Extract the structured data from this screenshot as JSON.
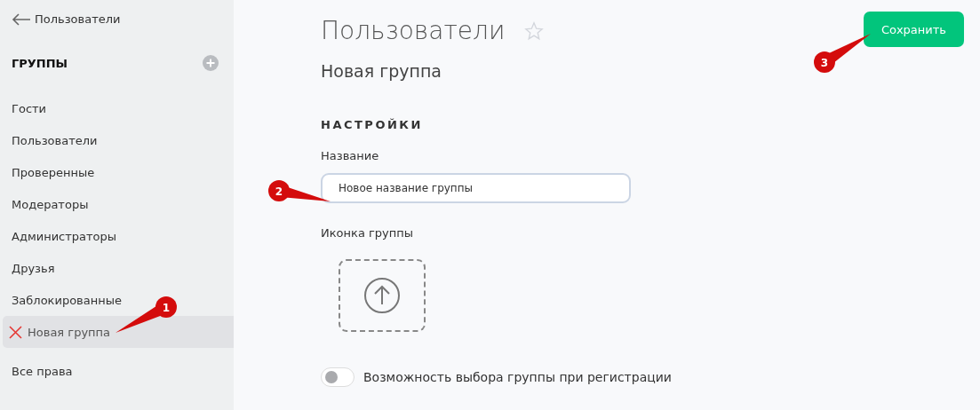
{
  "sidebar": {
    "back_link": "Пользователи",
    "section_title": "ГРУППЫ",
    "items": [
      {
        "label": "Гости",
        "selected": false
      },
      {
        "label": "Пользователи",
        "selected": false
      },
      {
        "label": "Проверенные",
        "selected": false
      },
      {
        "label": "Модераторы",
        "selected": false
      },
      {
        "label": "Администраторы",
        "selected": false
      },
      {
        "label": "Друзья",
        "selected": false
      },
      {
        "label": "Заблокированные",
        "selected": false
      },
      {
        "label": "Новая группа",
        "selected": true
      }
    ],
    "footer_item": "Все права"
  },
  "page": {
    "title": "Пользователи",
    "favorite": false,
    "subtitle": "Новая группа",
    "save_button": "Сохранить"
  },
  "settings": {
    "heading": "НАСТРОЙКИ",
    "name_label": "Название",
    "name_value": "Новое название группы",
    "icon_label": "Иконка группы",
    "toggle": {
      "label": "Возможность выбора группы при регистрации",
      "on": false
    }
  },
  "callouts": [
    {
      "number": "1"
    },
    {
      "number": "2"
    },
    {
      "number": "3"
    }
  ]
}
